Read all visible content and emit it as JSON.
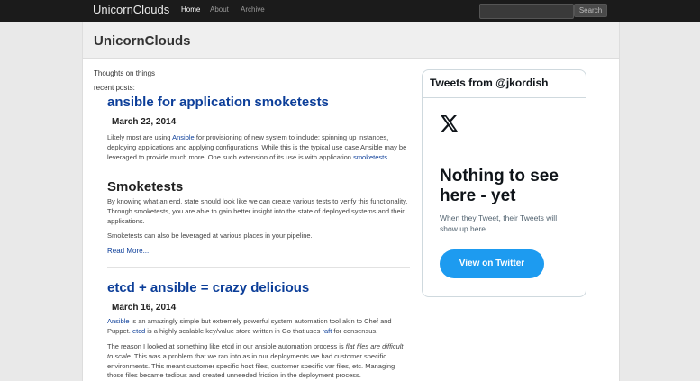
{
  "nav": {
    "brand": "UnicornClouds",
    "links": [
      "Home",
      "About",
      "Archive"
    ],
    "search_placeholder": "",
    "search_button": "Search"
  },
  "hero": {
    "title": "UnicornClouds"
  },
  "sidebar_text": {
    "tagline": "Thoughts on things",
    "recent_label": "recent posts:"
  },
  "posts": [
    {
      "title": "ansible for application smoketests",
      "date": "March 22, 2014",
      "p1": {
        "a": "Likely most are using ",
        "link1": "Ansible",
        "b": " for provisioning of new system to include: spinning up instances, deploying applications and applying configurations. While this is the typical use case Ansible may be leveraged to provide much more. One such extension of its use is with application ",
        "link2": "smoketests",
        "c": "."
      },
      "subheading": "Smoketests",
      "p2": "By knowing what an end, state should look like we can create various tests to verify this functionality. Through smoketests, you are able to gain better insight into the state of deployed systems and their applications.",
      "p3": "Smoketests can also be leveraged at various places in your pipeline.",
      "read_more": "Read More..."
    },
    {
      "title": "etcd + ansible = crazy delicious",
      "date": "March 16, 2014",
      "p1": {
        "link1": "Ansible",
        "a": " is an amazingly simple but extremely powerful system automation tool akin to Chef and Puppet. ",
        "link2": "etcd",
        "b": " is a highly scalable key/value store written in Go that uses ",
        "link3": "raft",
        "c": " for consensus."
      },
      "p2": {
        "a": "The reason I looked at something like etcd in our ansible automation process is ",
        "em": "flat files are difficult to scale",
        "b": ". This was a problem that we ran into as in our deployments we had customer specific environments. This meant customer specific host files, customer specific var files, etc. Managing those files became tedious and created unneeded friction in the deployment process."
      }
    }
  ],
  "twitter": {
    "title": "Tweets from @jkordish",
    "icon": "x-logo-icon",
    "empty_title": "Nothing to see here - yet",
    "empty_sub": "When they Tweet, their Tweets will show up here.",
    "button": "View on Twitter",
    "accent": "#1d9bf0"
  }
}
